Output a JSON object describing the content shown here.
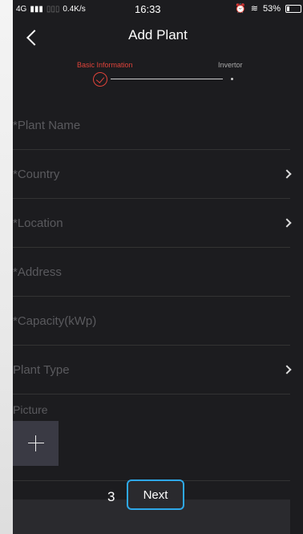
{
  "status_bar": {
    "network": "4G",
    "signal_secondary": "",
    "speed": "0.4K/s",
    "time": "16:33",
    "battery": "53%"
  },
  "navbar": {
    "title": "Add Plant"
  },
  "steps": [
    {
      "label": "Basic Information",
      "state": "active"
    },
    {
      "label": "Invertor",
      "state": "pending"
    }
  ],
  "fields": [
    {
      "label": "*Plant Name",
      "has_chevron": false
    },
    {
      "label": "*Country",
      "has_chevron": true
    },
    {
      "label": "*Location",
      "has_chevron": true
    },
    {
      "label": "*Address",
      "has_chevron": false
    },
    {
      "label": "*Capacity(kWp)",
      "has_chevron": false
    },
    {
      "label": "Plant Type",
      "has_chevron": true
    }
  ],
  "picture": {
    "label": "Picture"
  },
  "footer": {
    "marker": "3",
    "next_label": "Next"
  },
  "colors": {
    "accent_red": "#e0433a",
    "accent_blue": "#2ea8e8",
    "background": "#1c1c1f"
  }
}
